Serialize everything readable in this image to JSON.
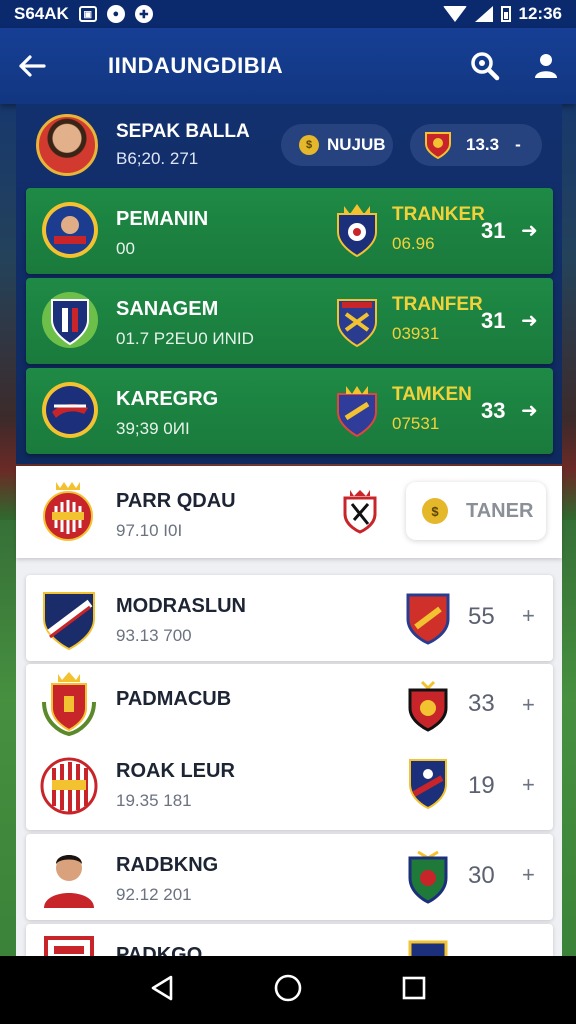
{
  "status_bar": {
    "left_text": "S64AK",
    "time": "12:36"
  },
  "app_bar": {
    "title": "IINDAUNGDIBIA"
  },
  "profile": {
    "name": "SEPAK BALLA",
    "sub": "B6;20. 271"
  },
  "pills": [
    {
      "label": "NUJUB"
    },
    {
      "label": "13.3",
      "suffix": "-"
    }
  ],
  "green_rows": [
    {
      "name": "PEMANIN",
      "sub": "00",
      "mid_label": "TRANKER",
      "mid_value": "06.96",
      "score": "31",
      "arrow": "➜"
    },
    {
      "name": "SANAGEM",
      "sub": "01.7  P2EU0 ИNID",
      "mid_label": "TRANFER",
      "mid_value": "03931",
      "score": "31",
      "arrow": "➜"
    },
    {
      "name": "KAREGRG",
      "sub": "39;39  0ИI",
      "mid_label": "TAMKEN",
      "mid_value": "07531",
      "score": "33",
      "arrow": "➜"
    }
  ],
  "highlight_row": {
    "name": "PARR QDAU",
    "sub": "97.10  Ι0Ι",
    "button_label": "TANER"
  },
  "white_rows": [
    {
      "name": "MODRASLUN",
      "sub": "93.13  700",
      "score": "55",
      "arrow": "+"
    },
    {
      "name": "PADMACUB",
      "sub": "",
      "score": "33",
      "arrow": "+"
    },
    {
      "name": "ROAK LEUR",
      "sub": "19.35  181",
      "score": "19",
      "arrow": "+"
    },
    {
      "name": "RADBKNG",
      "sub": "92.12  201",
      "score": "30",
      "arrow": "+"
    },
    {
      "name": "PADKGO",
      "sub": "",
      "score": "",
      "arrow": ""
    }
  ],
  "colors": {
    "app_bar": "#163f95",
    "green_row": "#1e8a45",
    "accent_gold": "#f2d23a"
  },
  "icons": [
    "back-arrow-icon",
    "search-icon",
    "profile-icon",
    "nav-back-icon",
    "nav-home-icon",
    "nav-recents-icon"
  ]
}
